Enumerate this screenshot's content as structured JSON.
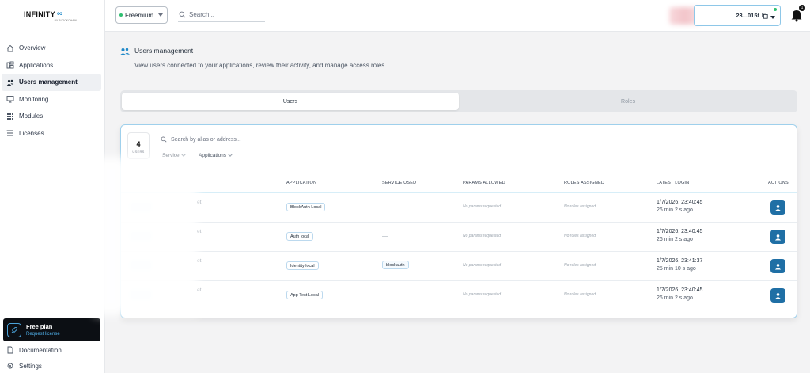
{
  "brand": {
    "name": "INFINITY",
    "symbol": "∞",
    "sub": "BY BLOCKCHAIN"
  },
  "sidebar": {
    "items": [
      {
        "label": "Overview",
        "icon": "home-icon"
      },
      {
        "label": "Applications",
        "icon": "apps-icon"
      },
      {
        "label": "Users management",
        "icon": "users-icon",
        "active": true
      },
      {
        "label": "Monitoring",
        "icon": "monitor-icon"
      },
      {
        "label": "Modules",
        "icon": "grid-icon"
      },
      {
        "label": "Licenses",
        "icon": "list-icon"
      }
    ],
    "plan": {
      "title": "Free plan",
      "link": "Request license"
    },
    "documentation": "Documentation",
    "settings": "Settings"
  },
  "topbar": {
    "plan_select": "Freemium",
    "search_placeholder": "Search...",
    "wallet_short": "23...015f",
    "notifications_count": "1"
  },
  "page": {
    "title": "Users management",
    "description": "View users connected to your applications, review their activity, and manage access roles."
  },
  "tabs": [
    {
      "label": "Users",
      "active": true
    },
    {
      "label": "Roles",
      "active": false
    }
  ],
  "users_panel": {
    "count": "4",
    "count_label": "USERS",
    "search_placeholder": "Search by alias or address...",
    "filters": [
      "Service",
      "Applications"
    ],
    "columns": [
      "Application",
      "Service used",
      "Params allowed",
      "Roles assigned",
      "Latest login",
      "Actions"
    ],
    "rows": [
      {
        "alias_suffix": "et",
        "application": "BlockAuth Local",
        "service": "—",
        "params": "No params requested",
        "roles": "No roles assigned",
        "login_date": "1/7/2026, 23:40:45",
        "login_ago": "26 min 2 s ago"
      },
      {
        "alias_suffix": "et",
        "application": "Auth local",
        "service": "—",
        "params": "No params requested",
        "roles": "No roles assigned",
        "login_date": "1/7/2026, 23:40:45",
        "login_ago": "26 min 2 s ago"
      },
      {
        "alias_suffix": "et",
        "application": "Identity local",
        "service": "blockauth",
        "params": "No params requested",
        "roles": "No roles assigned",
        "login_date": "1/7/2026, 23:41:37",
        "login_ago": "25 min 10 s ago"
      },
      {
        "alias_suffix": "et",
        "application": "App Test Local",
        "service": "—",
        "params": "No params requested",
        "roles": "No roles assigned",
        "login_date": "1/7/2026, 23:40:45",
        "login_ago": "26 min 2 s ago"
      }
    ]
  },
  "colors": {
    "accent": "#1f6fa5",
    "brand_blue": "#1e88c8",
    "status_green": "#2fbf71"
  }
}
